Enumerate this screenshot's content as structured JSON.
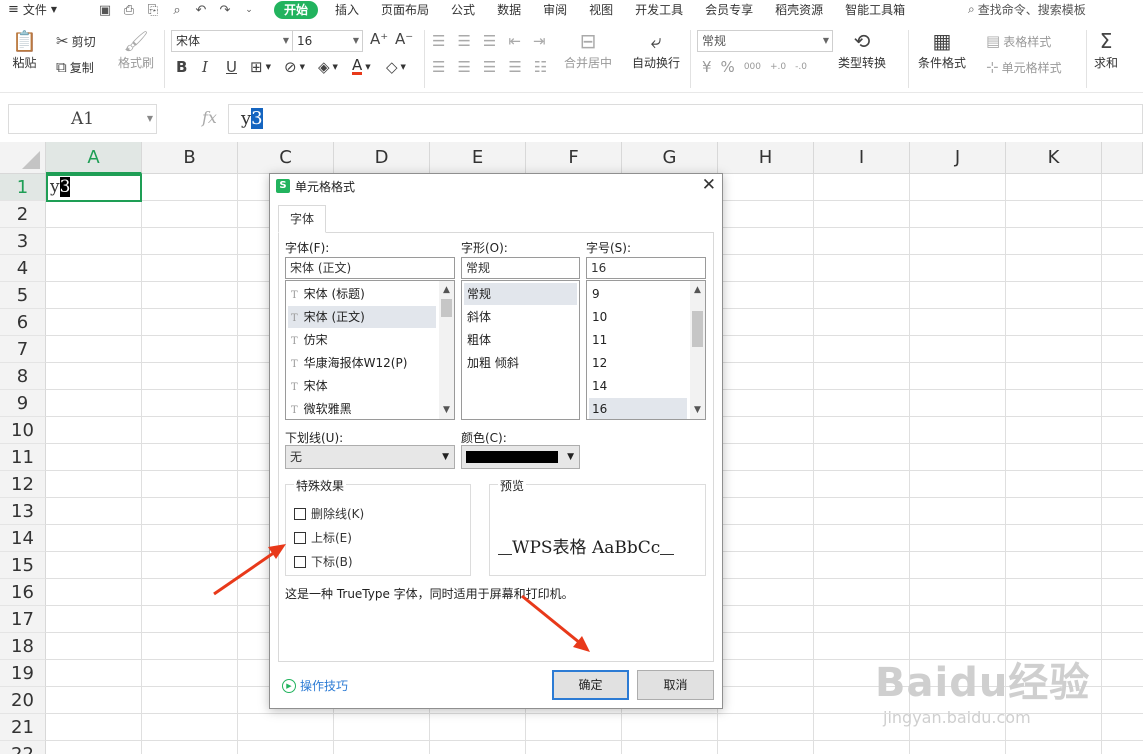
{
  "menubar": {
    "file_label": "文件",
    "tabs": [
      "开始",
      "插入",
      "页面布局",
      "公式",
      "数据",
      "审阅",
      "视图",
      "开发工具",
      "会员专享",
      "稻壳资源",
      "智能工具箱"
    ],
    "search_label": "查找命令、搜索模板"
  },
  "ribbon": {
    "paste": "粘贴",
    "cut": "剪切",
    "copy": "复制",
    "format_painter": "格式刷",
    "font_name": "宋体",
    "font_size": "16",
    "merge_center": "合并居中",
    "wrap_text": "自动换行",
    "number_format": "常规",
    "type_convert": "类型转换",
    "conditional_format": "条件格式",
    "table_style": "表格样式",
    "cell_style": "单元格样式",
    "sum": "求和",
    "currency_symbol": "¥",
    "percent_symbol": "%",
    "thousands_symbol": "000"
  },
  "formula_bar": {
    "cell_ref": "A1",
    "fx": "fx",
    "content_plain": "y",
    "content_selected": "3"
  },
  "grid": {
    "columns": [
      "A",
      "B",
      "C",
      "D",
      "E",
      "F",
      "G",
      "H",
      "I",
      "J",
      "K"
    ],
    "rows": [
      "1",
      "2",
      "3",
      "4",
      "5",
      "6",
      "7",
      "8",
      "9",
      "10",
      "11",
      "12",
      "13",
      "14",
      "15",
      "16",
      "17",
      "18",
      "19",
      "20",
      "21",
      "22"
    ],
    "active_column": "A",
    "active_row": "1",
    "cell_a1_plain": "y",
    "cell_a1_selected": "3"
  },
  "dialog": {
    "title": "单元格格式",
    "tab": "字体",
    "font_label": "字体(F):",
    "font_value": "宋体 (正文)",
    "font_items": [
      "宋体 (标题)",
      "宋体 (正文)",
      "仿宋",
      "华康海报体W12(P)",
      "宋体",
      "微软雅黑"
    ],
    "font_selected_index": 1,
    "style_label": "字形(O):",
    "style_value": "常规",
    "style_items": [
      "常规",
      "斜体",
      "粗体",
      "加粗 倾斜"
    ],
    "style_selected_index": 0,
    "size_label": "字号(S):",
    "size_value": "16",
    "size_items": [
      "9",
      "10",
      "11",
      "12",
      "14",
      "16"
    ],
    "size_selected_index": 5,
    "underline_label": "下划线(U):",
    "underline_value": "无",
    "color_label": "颜色(C):",
    "color_value": "#000000",
    "effects_label": "特殊效果",
    "strikethrough": "删除线(K)",
    "superscript": "上标(E)",
    "subscript": "下标(B)",
    "preview_label": "预览",
    "preview_text": "WPS表格  AaBbCc",
    "note": "这是一种 TrueType 字体，同时适用于屏幕和打印机。",
    "ok": "确定",
    "cancel": "取消",
    "tips": "操作技巧"
  },
  "watermark": {
    "logo_text": "Baidu经验",
    "url": "jingyan.baidu.com"
  },
  "colors": {
    "accent": "#22b35e",
    "arrow": "#e8391a",
    "selection": "#1565c0"
  }
}
